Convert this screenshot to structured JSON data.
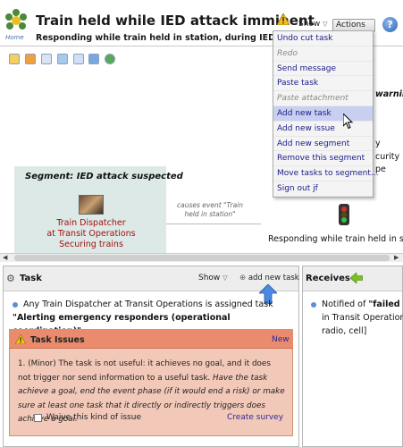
{
  "header": {
    "logo_text": "Home",
    "title": "Train held while IED attack imminent",
    "subtitle": "Responding while train held in station, during IED attack immi",
    "show_label": "Show",
    "actions_label": "Actions",
    "help_symbol": "?"
  },
  "actions_menu": {
    "items": [
      {
        "label": "Undo cut task",
        "state": "enabled"
      },
      {
        "label": "Redo",
        "state": "disabled"
      },
      {
        "label": "Send message",
        "state": "enabled"
      },
      {
        "label": "Paste task",
        "state": "enabled"
      },
      {
        "label": "Paste attachment",
        "state": "disabled"
      },
      {
        "label": "Add new task",
        "state": "hover"
      },
      {
        "label": "Add new issue",
        "state": "enabled"
      },
      {
        "label": "Add new segment",
        "state": "enabled"
      },
      {
        "label": "Remove this segment",
        "state": "enabled"
      },
      {
        "label": "Move tasks to segment...",
        "state": "enabled"
      },
      {
        "label": "Sign out jf",
        "state": "enabled"
      }
    ]
  },
  "canvas": {
    "segment_title": "Segment: IED attack suspected",
    "task_label_line1": "Train Dispatcher",
    "task_label_line2": "at Transit Operations",
    "task_label_line3": "Securing trains",
    "causes_text": "causes event \"Train held in station\"",
    "event_label": "Responding while train held in st",
    "partial_warning": "warnin",
    "partial_y": "y",
    "partial_security": "curity",
    "partial_pe": "pe"
  },
  "task_panel": {
    "heading": "Task",
    "show_label": "Show",
    "add_new_task": "add new task",
    "description_prefix": "Any Train Dispatcher at Transit Operations is assigned task ",
    "description_task": "\"Alerting emergency responders (operational coordination)\"",
    "description_suffix": " .",
    "issues": {
      "title": "Task Issues",
      "new_label": "New",
      "item_number": "1.",
      "item_plain": "(Minor) The task is not useful: it achieves no goal, and it does not trigger nor send information to a useful task. ",
      "item_italic": "Have the task achieve a goal, end the event phase (if it would end a risk) or make sure at least one task that it directly or indirectly triggers does achieve a goal.",
      "waive_label": "Waive this kind of issue",
      "create_survey": "Create survey"
    }
  },
  "receives_panel": {
    "heading": "Receives",
    "line1_prefix": "Notified of ",
    "line1_bold": "\"failed to e",
    "line2": "in Transit Operations",
    "line3": "radio, cell]"
  },
  "colors": {
    "segment_bg": "#dde9e6",
    "task_label": "#a01010",
    "menu_hover": "#c9cff0",
    "issues_header": "#e98b6c",
    "issues_body": "#f2c8b8",
    "link": "#2a2a9a"
  },
  "icons": [
    "home-logo-icon",
    "warning-icon",
    "help-icon",
    "toolbar-icons",
    "traffic-light-icon",
    "gear-icon",
    "arrow-up-icon",
    "green-arrow-icon",
    "mouse-cursor-icon"
  ]
}
